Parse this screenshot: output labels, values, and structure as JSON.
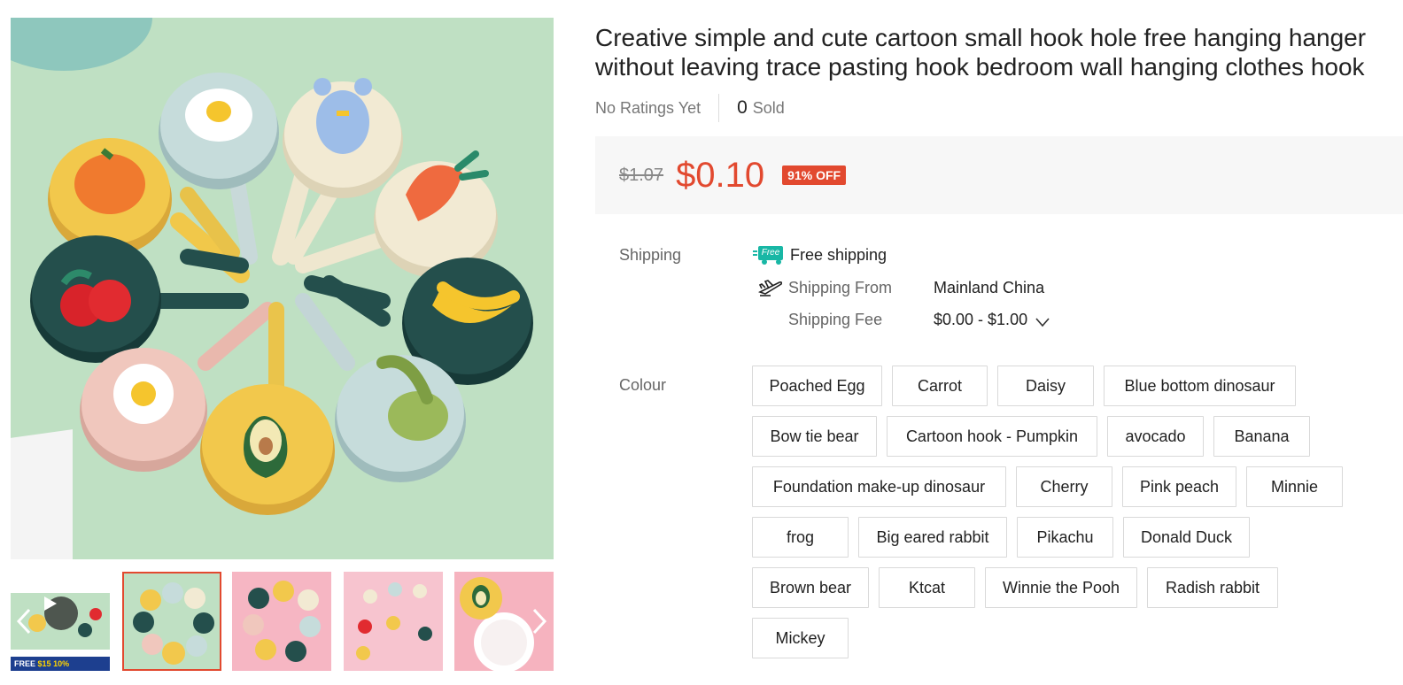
{
  "product": {
    "title": "Creative simple and cute cartoon small hook hole free hanging hanger without leaving trace pasting hook bedroom wall hanging clothes hook",
    "ratings_text": "No Ratings Yet",
    "sold_count": "0",
    "sold_label": "Sold"
  },
  "price": {
    "original": "$1.07",
    "current": "$0.10",
    "discount": "91% OFF"
  },
  "shipping": {
    "label": "Shipping",
    "free_badge": "Free",
    "free_text": "Free shipping",
    "from_label": "Shipping From",
    "from_value": "Mainland China",
    "fee_label": "Shipping Fee",
    "fee_value": "$0.00 - $1.00"
  },
  "colour": {
    "label": "Colour",
    "options": [
      "Poached Egg",
      "Carrot",
      "Daisy",
      "Blue bottom dinosaur",
      "Bow tie bear",
      "Cartoon hook - Pumpkin",
      "avocado",
      "Banana",
      "Foundation make-up dinosaur",
      "Cherry",
      "Pink peach",
      "Minnie",
      "frog",
      "Big eared rabbit",
      "Pikachu",
      "Donald Duck",
      "Brown bear",
      "Ktcat",
      "Winnie the Pooh",
      "Radish rabbit",
      "Mickey"
    ]
  },
  "gallery": {
    "promo_prefix": "FREE",
    "promo_amount": "$15",
    "promo_percent": "10%",
    "thumb_count": 5,
    "active_thumb": 1
  },
  "colors": {
    "accent": "#e2492f",
    "free_shipping": "#18b7a5",
    "price_bg": "#f7f7f7"
  },
  "icons": {
    "prev": "chevron-left-icon",
    "next": "chevron-right-icon",
    "play": "play-icon",
    "free_shipping": "free-shipping-truck-icon",
    "ship_from": "airplane-icon",
    "fee_dropdown": "chevron-down-icon"
  }
}
